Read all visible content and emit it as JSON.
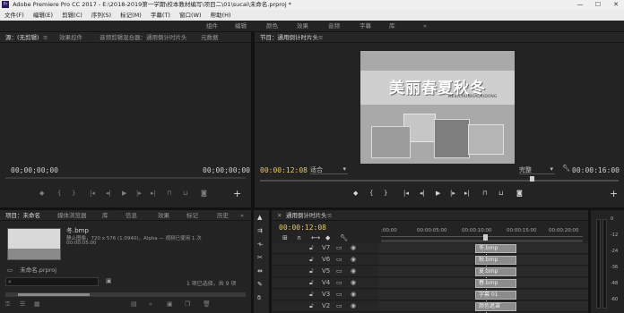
{
  "window": {
    "title": "Adobe Premiere Pro CC 2017 - E:\\2018-2019第一学期\\校本教材编写\\项目二\\01\\sucai\\未命名.prproj *",
    "min": "—",
    "max": "☐",
    "close": "✕"
  },
  "menu": [
    "文件(F)",
    "编辑(E)",
    "剪辑(C)",
    "序列(S)",
    "标记(M)",
    "字幕(T)",
    "窗口(W)",
    "帮助(H)"
  ],
  "workspaces": [
    "组件",
    "编辑",
    "颜色",
    "效果",
    "音频",
    "字幕",
    "库"
  ],
  "workspace_more": "»",
  "source_panel": {
    "tabs": [
      "源：(无剪辑)",
      "效果控件",
      "音频剪辑混合器：通用倒计时片头",
      "元数据"
    ],
    "menu_glyph": "≡",
    "timecode_left": "00;00;00;00",
    "timecode_right": "00;00;00;00"
  },
  "program_panel": {
    "tab": "节目：通用倒计时片头",
    "menu_glyph": "≡",
    "timecode_left": "00:00:12:08",
    "fit_label": "适合",
    "quality_label": "完整",
    "timecode_right": "00:00:16:00",
    "preview_title": "美丽春夏秋冬",
    "preview_subtitle": "MEILICHUNXIAQIUDONG"
  },
  "project_panel": {
    "tabs": [
      "项目：未命名",
      "媒体浏览器",
      "库",
      "信息",
      "效果",
      "标记",
      "历史"
    ],
    "more": "»",
    "asset_name": "冬.bmp",
    "asset_info_1": "静止图像，720 x 576 (1.0940)，Alpha — 视频已使用 1 次",
    "asset_info_2": "00:00:05:00",
    "project_file": "未命名.prproj",
    "search_placeholder": "",
    "status": "1 项已选择，共 9 项"
  },
  "timeline": {
    "tab": "通用倒计时片头",
    "menu_glyph": "≡",
    "timecode": "00:00:12:08",
    "ruler": [
      ":00:00",
      "00:00:05:00",
      "00:00:10:00",
      "00:00:15:00",
      "00:00:20:00"
    ],
    "tracks": [
      {
        "name": "V7",
        "clip": "冬.bmp"
      },
      {
        "name": "V6",
        "clip": "秋.bmp"
      },
      {
        "name": "V5",
        "clip": "夏.bmp"
      },
      {
        "name": "V4",
        "clip": "春.bmp"
      },
      {
        "name": "V3",
        "clip": "字幕 01"
      },
      {
        "name": "V2",
        "clip": "颜色遮罩"
      }
    ]
  },
  "meter": {
    "scale": [
      "0",
      "-12",
      "-24",
      "-36",
      "-48",
      "-60"
    ]
  },
  "colors": {
    "bg": "#1e1e1e",
    "panel": "#232323",
    "accent": "#2d8ceb",
    "clip": "#8c8c8c"
  }
}
